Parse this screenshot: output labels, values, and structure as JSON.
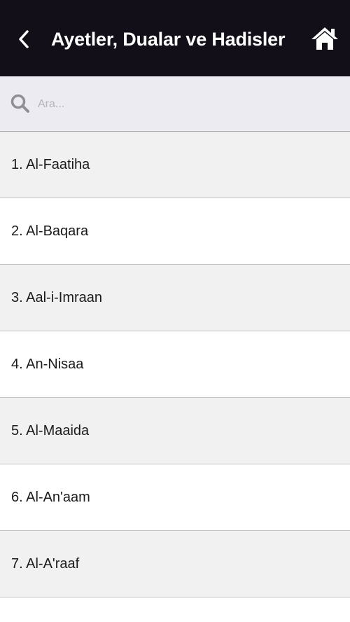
{
  "header": {
    "title": "Ayetler, Dualar ve Hadisler",
    "back_icon": "chevron-left-icon",
    "home_icon": "home-icon"
  },
  "search": {
    "placeholder": "Ara...",
    "value": "",
    "icon": "search-icon"
  },
  "list": {
    "items": [
      {
        "label": "1. Al-Faatiha"
      },
      {
        "label": "2. Al-Baqara"
      },
      {
        "label": "3. Aal-i-Imraan"
      },
      {
        "label": "4. An-Nisaa"
      },
      {
        "label": "5. Al-Maaida"
      },
      {
        "label": "6. Al-An'aam"
      },
      {
        "label": "7. Al-A'raaf"
      }
    ]
  },
  "colors": {
    "header_bg": "#120f19",
    "search_bg": "#ebebf1",
    "row_alt_bg": "#f1f1f1"
  }
}
